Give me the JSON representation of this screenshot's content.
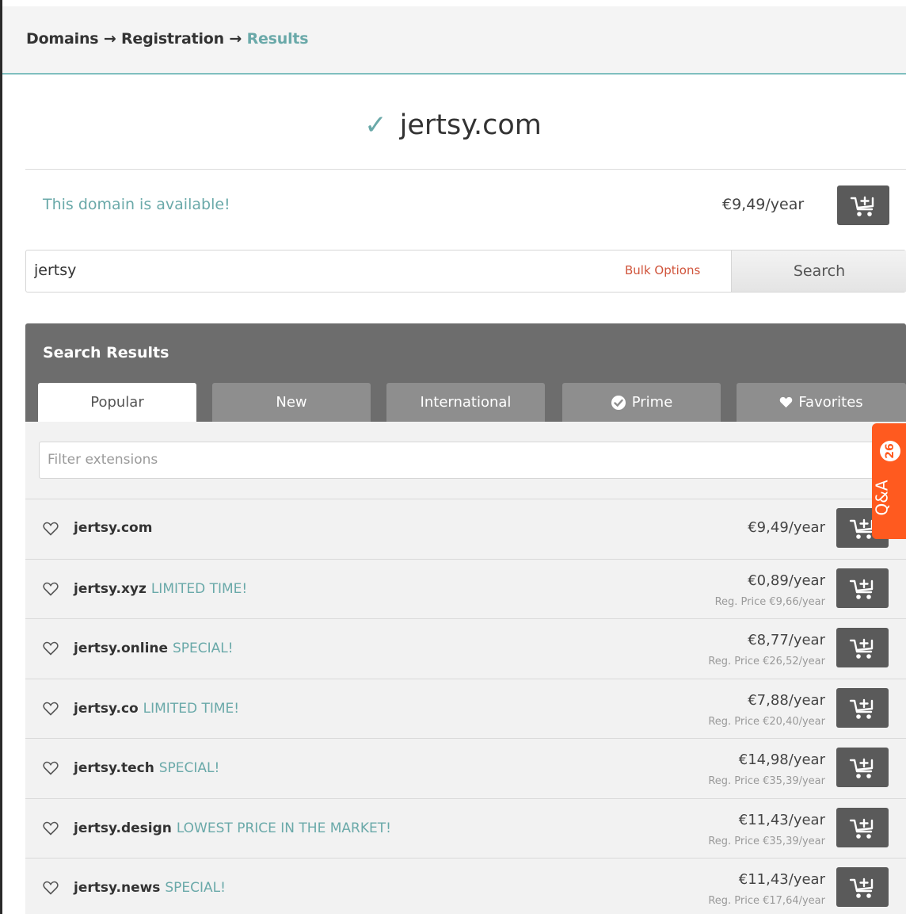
{
  "breadcrumb": {
    "part1": "Domains",
    "arrow1": "→",
    "part2": "Registration",
    "arrow2": "→",
    "current": "Results"
  },
  "domain_check": {
    "domain": "jertsy.com",
    "status_text": "This domain is available!",
    "price": "€9,49/year"
  },
  "search": {
    "value": "jertsy",
    "bulk_label": "Bulk Options",
    "button_label": "Search"
  },
  "results": {
    "title": "Search Results",
    "tabs": [
      {
        "label": "Popular",
        "active": true,
        "icon": ""
      },
      {
        "label": "New",
        "active": false,
        "icon": ""
      },
      {
        "label": "International",
        "active": false,
        "icon": ""
      },
      {
        "label": "Prime",
        "active": false,
        "icon": "check-circle-icon"
      },
      {
        "label": "Favorites",
        "active": false,
        "icon": "heart-icon"
      }
    ],
    "filter_placeholder": "Filter extensions",
    "rows": [
      {
        "name": "jertsy.com",
        "tag": "",
        "price": "€9,49/year",
        "reg": ""
      },
      {
        "name": "jertsy.xyz",
        "tag": "LIMITED TIME!",
        "price": "€0,89/year",
        "reg": "Reg. Price €9,66/year"
      },
      {
        "name": "jertsy.online",
        "tag": "SPECIAL!",
        "price": "€8,77/year",
        "reg": "Reg. Price €26,52/year"
      },
      {
        "name": "jertsy.co",
        "tag": "LIMITED TIME!",
        "price": "€7,88/year",
        "reg": "Reg. Price €20,40/year"
      },
      {
        "name": "jertsy.tech",
        "tag": "SPECIAL!",
        "price": "€14,98/year",
        "reg": "Reg. Price €35,39/year"
      },
      {
        "name": "jertsy.design",
        "tag": "LOWEST PRICE IN THE MARKET!",
        "price": "€11,43/year",
        "reg": "Reg. Price €35,39/year"
      },
      {
        "name": "jertsy.news",
        "tag": "SPECIAL!",
        "price": "€11,43/year",
        "reg": "Reg. Price €17,64/year"
      }
    ]
  },
  "qa_widget": {
    "label": "Q&A",
    "count": "26"
  },
  "colors": {
    "accent_teal": "#6aa9a9",
    "qa_orange": "#ff5a1f",
    "dark_button": "#5a5a5a",
    "bulk_red": "#d0543b"
  }
}
